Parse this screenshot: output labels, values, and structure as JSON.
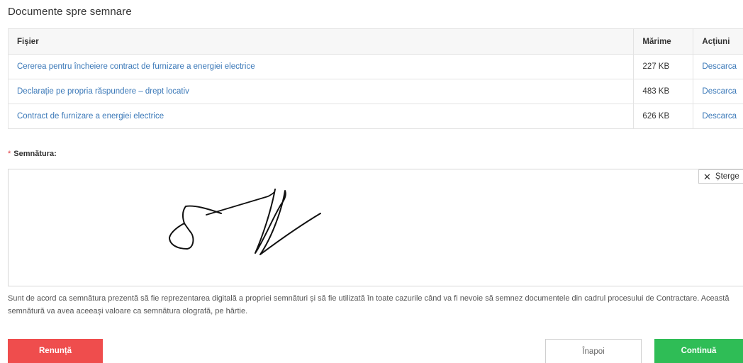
{
  "page": {
    "title": "Documente spre semnare"
  },
  "table": {
    "headers": {
      "file": "Fișier",
      "size": "Mărime",
      "actions": "Acțiuni"
    },
    "rows": [
      {
        "file": "Cererea pentru încheiere contract de furnizare a energiei electrice",
        "size": "227 KB",
        "action": "Descarca"
      },
      {
        "file": "Declarație pe propria răspundere – drept locativ",
        "size": "483 KB",
        "action": "Descarca"
      },
      {
        "file": "Contract de furnizare a energiei electrice",
        "size": "626 KB",
        "action": "Descarca"
      }
    ]
  },
  "signature": {
    "required_mark": "*",
    "label": "Semnătura:",
    "clear_label": "Șterge",
    "clear_icon": "close-icon"
  },
  "agreement": "Sunt de acord ca semnătura prezentă să fie reprezentarea digitală a propriei semnături și să fie utilizată în toate cazurile când va fi nevoie să semnez documentele din cadrul procesului de Contractare. Această semnătură va avea aceeași valoare ca semnătura olografă, pe hârtie.",
  "buttons": {
    "cancel": "Renunță",
    "back": "Înapoi",
    "continue": "Continuă"
  },
  "colors": {
    "link": "#3a78b8",
    "cancel": "#ef4d4d",
    "continue": "#2fbd56",
    "required": "#e0383e"
  }
}
